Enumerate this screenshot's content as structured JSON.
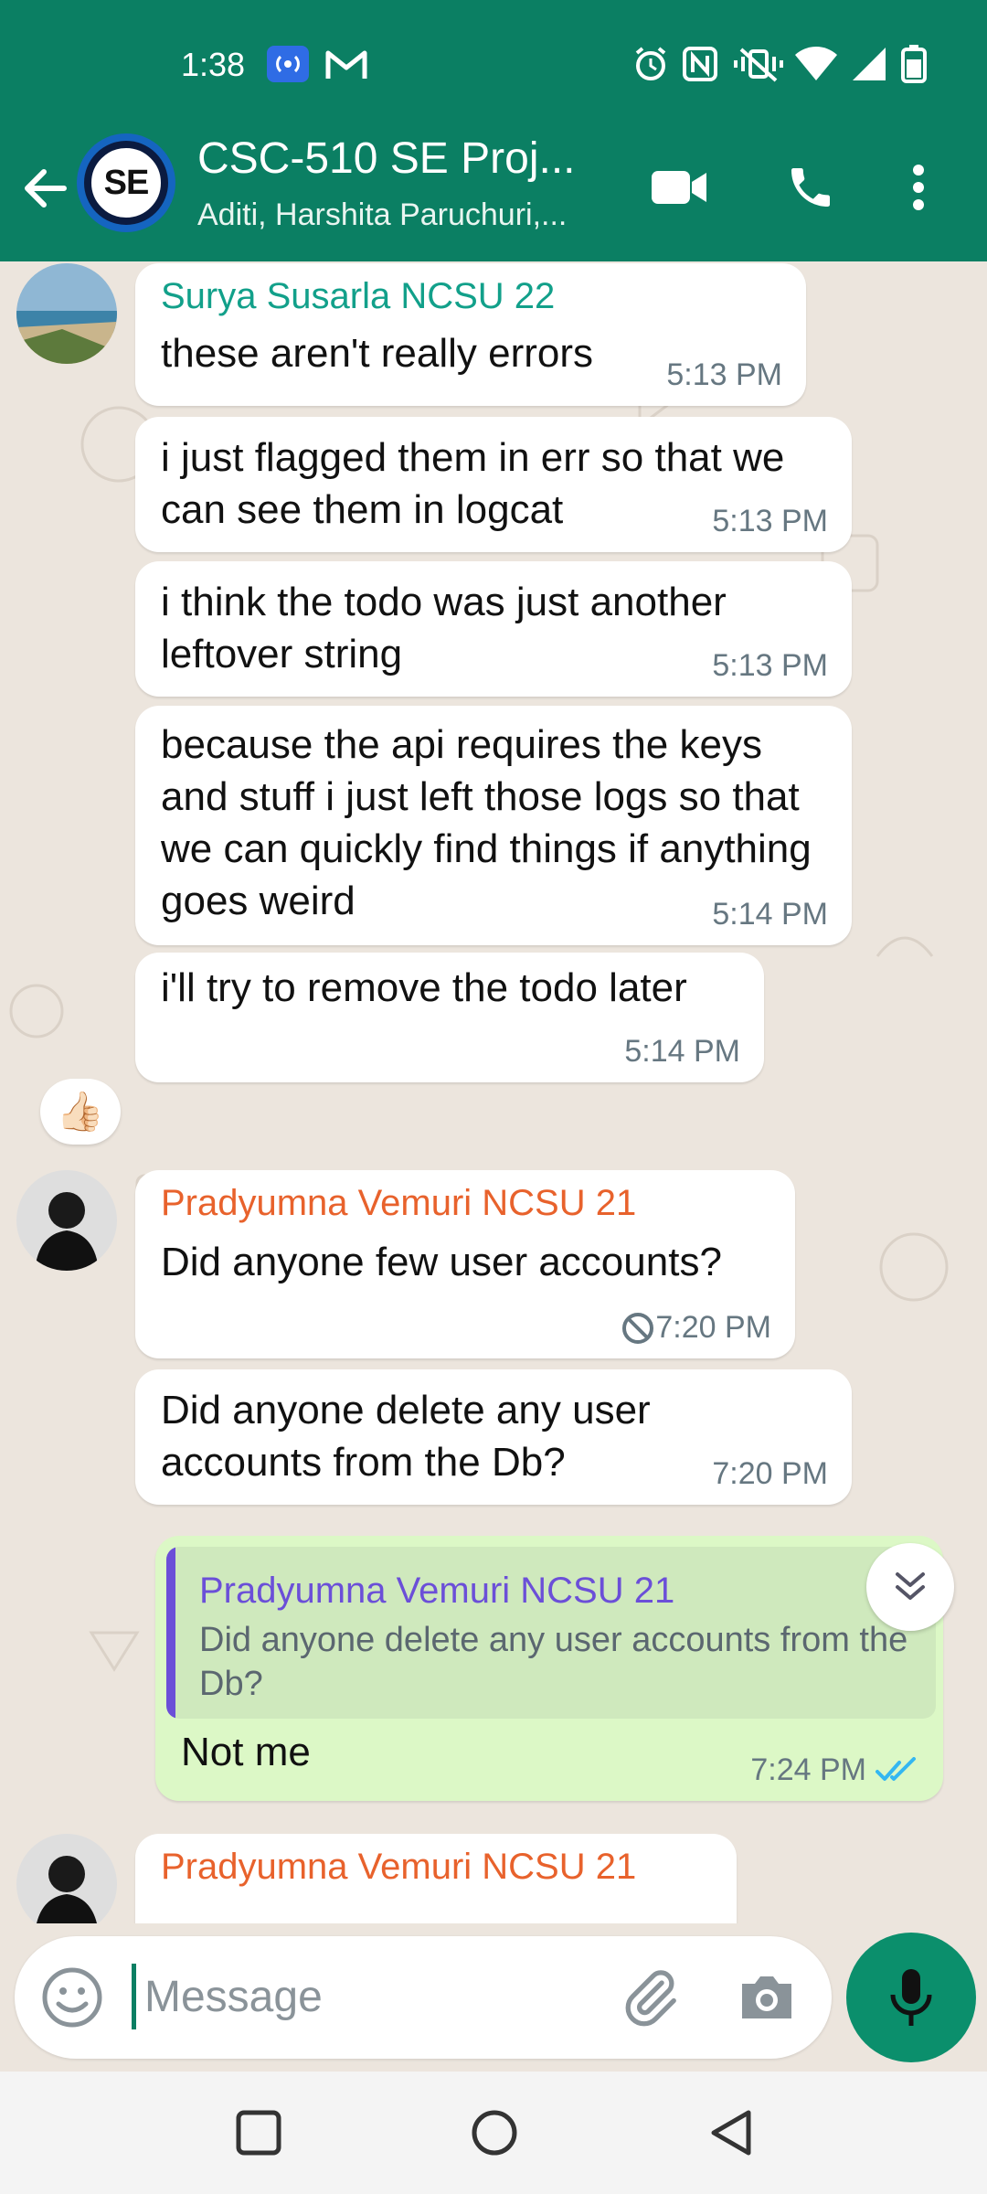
{
  "status_bar": {
    "time": "1:38",
    "icons": [
      "hotspot-icon",
      "gmail-icon",
      "alarm-icon",
      "nfc-icon",
      "vibrate-icon",
      "wifi-icon",
      "signal-icon",
      "battery-icon"
    ]
  },
  "header": {
    "title": "CSC-510 SE Proj...",
    "subtitle": "Aditi, Harshita Paruchuri,...",
    "avatar_text": "SE",
    "brand_color": "#0b7f63"
  },
  "messages": [
    {
      "sender": "Surya Susarla NCSU 22",
      "sender_color": "#12a08a",
      "text": "these aren't really errors",
      "time": "5:13 PM"
    },
    {
      "text": "i just flagged them in err so that we can see them in logcat",
      "time": "5:13 PM"
    },
    {
      "text": "i think the todo was just another leftover string",
      "time": "5:13 PM"
    },
    {
      "text": "because the api requires the keys and stuff i just left those logs so that we can quickly find things if anything goes weird",
      "time": "5:14 PM"
    },
    {
      "text": "i'll try to remove the todo later",
      "time": "5:14 PM",
      "reaction": "👍🏻"
    },
    {
      "sender": "Pradyumna Vemuri NCSU 21",
      "sender_color": "#e8622c",
      "text": "Did anyone few user accounts?",
      "time": "7:20 PM",
      "deleted_icon": "blocked-icon"
    },
    {
      "text": "Did anyone delete any user accounts from the Db?",
      "time": "7:20 PM"
    },
    {
      "outgoing": true,
      "quote_sender": "Pradyumna Vemuri NCSU 21",
      "quote_text": "Did anyone delete any user accounts from the Db?",
      "text": "Not me",
      "time": "7:24 PM",
      "status": "read",
      "tick_color": "#34b7f1"
    },
    {
      "sender": "Pradyumna Vemuri NCSU 21",
      "sender_color": "#e8622c",
      "text": "...",
      "time": ""
    }
  ],
  "composer": {
    "placeholder": "Message"
  }
}
